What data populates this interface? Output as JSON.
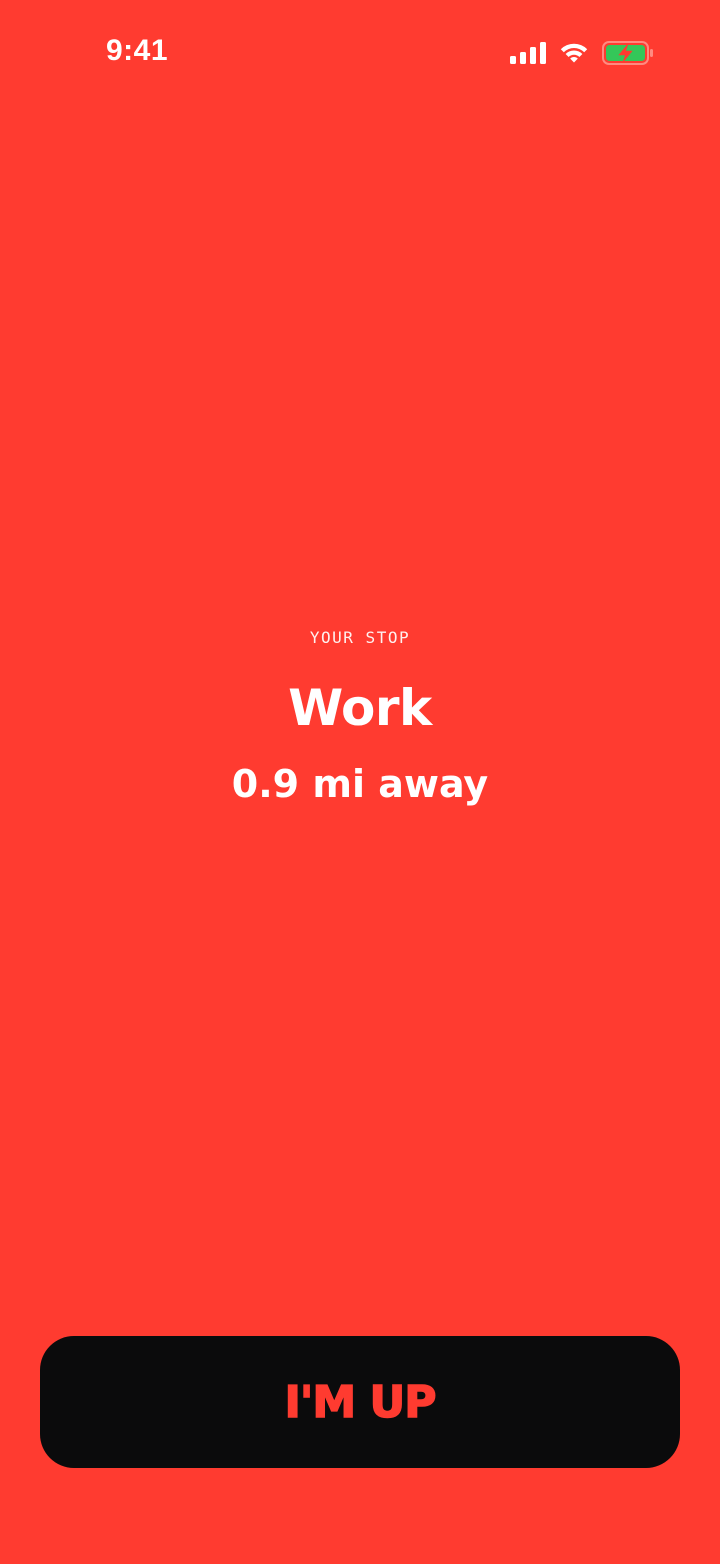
{
  "status_bar": {
    "time": "9:41",
    "icons": [
      "cellular-signal-icon",
      "wifi-icon",
      "battery-charging-icon"
    ]
  },
  "stop": {
    "eyebrow": "YOUR STOP",
    "name": "Work",
    "distance": "0.9 mi away"
  },
  "action": {
    "label": "I'M UP"
  },
  "colors": {
    "background": "#FF3B30",
    "button": "#0B0B0C",
    "button_text": "#FF3B30",
    "battery_fill": "#34C759"
  }
}
